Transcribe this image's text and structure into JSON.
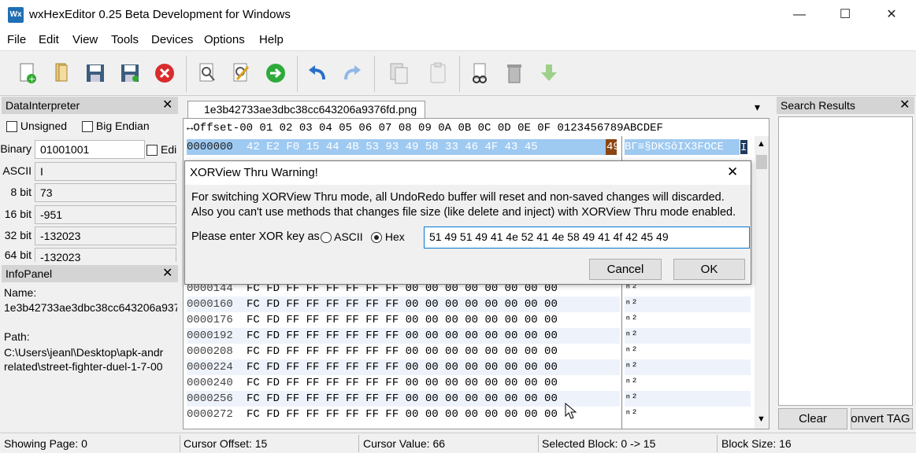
{
  "window": {
    "title": "wxHexEditor 0.25 Beta Development for Windows",
    "logo": "Wx"
  },
  "menu": [
    "File",
    "Edit",
    "View",
    "Tools",
    "Devices",
    "Options",
    "Help"
  ],
  "toolbar": [
    "new-file",
    "open-file",
    "save",
    "save-as",
    "close",
    "find",
    "find-replace",
    "goto",
    "undo",
    "redo",
    "copy",
    "paste",
    "cut",
    "delete",
    "insert"
  ],
  "data_interpreter": {
    "title": "DataInterpreter",
    "unsigned": "Unsigned",
    "big_endian": "Big Endian",
    "binary_label": "Binary",
    "binary_value": "01001001",
    "edit_label": "Edi",
    "rows": [
      {
        "label": "ASCII",
        "value": "I"
      },
      {
        "label": "8 bit",
        "value": "73"
      },
      {
        "label": "16 bit",
        "value": "-951"
      },
      {
        "label": "32 bit",
        "value": "-132023"
      },
      {
        "label": "64 bit",
        "value": "-132023"
      }
    ]
  },
  "info_panel": {
    "title": "InfoPanel",
    "name_label": "Name:",
    "name_value": "1e3b42733ae3dbc38cc643206a937",
    "path_label": "Path:",
    "path_line1": "C:\\Users\\jeanl\\Desktop\\apk-andr",
    "path_line2": "related\\street-fighter-duel-1-7-00"
  },
  "tab": {
    "label": "1e3b42733ae3dbc38cc643206a9376fd.png",
    "dropdown": "▾"
  },
  "hex": {
    "header": "↔Offset-00 01 02 03 04 05 06 07 08 09 0A 0B 0C 0D 0E 0F 0123456789ABCDEF",
    "first_offset": "0000000",
    "first_bytes": "42 E2 F0 15 44 4B 53 93 49 58 33 46 4F 43 45 ",
    "first_cursor": "49",
    "first_text": "BΓ≡§DKSôIX3FOCE",
    "first_text_cursor": "I",
    "rows": [
      {
        "offset": "0000144",
        "bytes": "FC FD FF FF FF FF FF FF 00 00 00 00 00 00 00 00",
        "text": "ⁿ²"
      },
      {
        "offset": "0000160",
        "bytes": "FC FD FF FF FF FF FF FF 00 00 00 00 00 00 00 00",
        "text": "ⁿ²"
      },
      {
        "offset": "0000176",
        "bytes": "FC FD FF FF FF FF FF FF 00 00 00 00 00 00 00 00",
        "text": "ⁿ²"
      },
      {
        "offset": "0000192",
        "bytes": "FC FD FF FF FF FF FF FF 00 00 00 00 00 00 00 00",
        "text": "ⁿ²"
      },
      {
        "offset": "0000208",
        "bytes": "FC FD FF FF FF FF FF FF 00 00 00 00 00 00 00 00",
        "text": "ⁿ²"
      },
      {
        "offset": "0000224",
        "bytes": "FC FD FF FF FF FF FF FF 00 00 00 00 00 00 00 00",
        "text": "ⁿ²"
      },
      {
        "offset": "0000240",
        "bytes": "FC FD FF FF FF FF FF FF 00 00 00 00 00 00 00 00",
        "text": "ⁿ²"
      },
      {
        "offset": "0000256",
        "bytes": "FC FD FF FF FF FF FF FF 00 00 00 00 00 00 00 00",
        "text": "ⁿ²"
      },
      {
        "offset": "0000272",
        "bytes": "FC FD FF FF FF FF FF FF 00 00 00 00 00 00 00 00",
        "text": "ⁿ²"
      }
    ]
  },
  "dialog": {
    "title": "XORView Thru Warning!",
    "line1": "For switching XORView Thru mode, all UndoRedo buffer will reset and non-saved changes will discarded.",
    "line2": "Also you can't use methods that changes file size (like delete and inject) with XORView Thru mode enabled.",
    "prompt": "Please enter XOR key as",
    "opt_ascii": "ASCII",
    "opt_hex": "Hex",
    "key_value": "51 49 51 49 41 4e 52 41 4e 58 49 41 4f 42 45 49",
    "cancel": "Cancel",
    "ok": "OK"
  },
  "search": {
    "title": "Search Results",
    "clear": "Clear",
    "convert": "Convert TAG"
  },
  "status": {
    "page": "Showing Page: 0",
    "cursor_offset": "Cursor Offset: 15",
    "cursor_value": "Cursor Value: 66",
    "selected_block": "Selected Block: 0 -> 15",
    "block_size": "Block Size: 16"
  },
  "colors": {
    "selection": "#9ec9f1",
    "cursor": "#8b4513",
    "alt_row": "#eef3fb"
  }
}
